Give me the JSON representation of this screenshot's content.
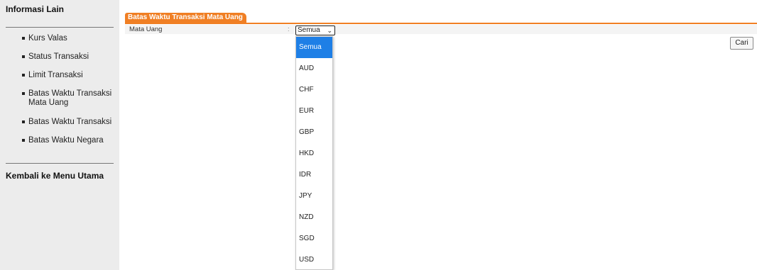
{
  "sidebar": {
    "title": "Informasi Lain",
    "items": [
      {
        "label": "Kurs Valas"
      },
      {
        "label": "Status Transaksi"
      },
      {
        "label": "Limit Transaksi"
      },
      {
        "label": "Batas Waktu Transaksi Mata Uang"
      },
      {
        "label": "Batas Waktu Transaksi"
      },
      {
        "label": "Batas Waktu Negara"
      }
    ],
    "back_label": "Kembali ke Menu Utama"
  },
  "main": {
    "tab_label": "Batas Waktu Transaksi Mata Uang",
    "field_label": "Mata Uang",
    "field_separator": ":",
    "currency_select": {
      "value": "Semua",
      "options": [
        "Semua",
        "AUD",
        "CHF",
        "EUR",
        "GBP",
        "HKD",
        "IDR",
        "JPY",
        "NZD",
        "SGD",
        "USD"
      ],
      "selected_index": 0
    },
    "search_label": "Cari"
  },
  "colors": {
    "accent": "#f07f24",
    "sidebar_bg": "#ececec",
    "option_highlight": "#1e7fe6"
  }
}
